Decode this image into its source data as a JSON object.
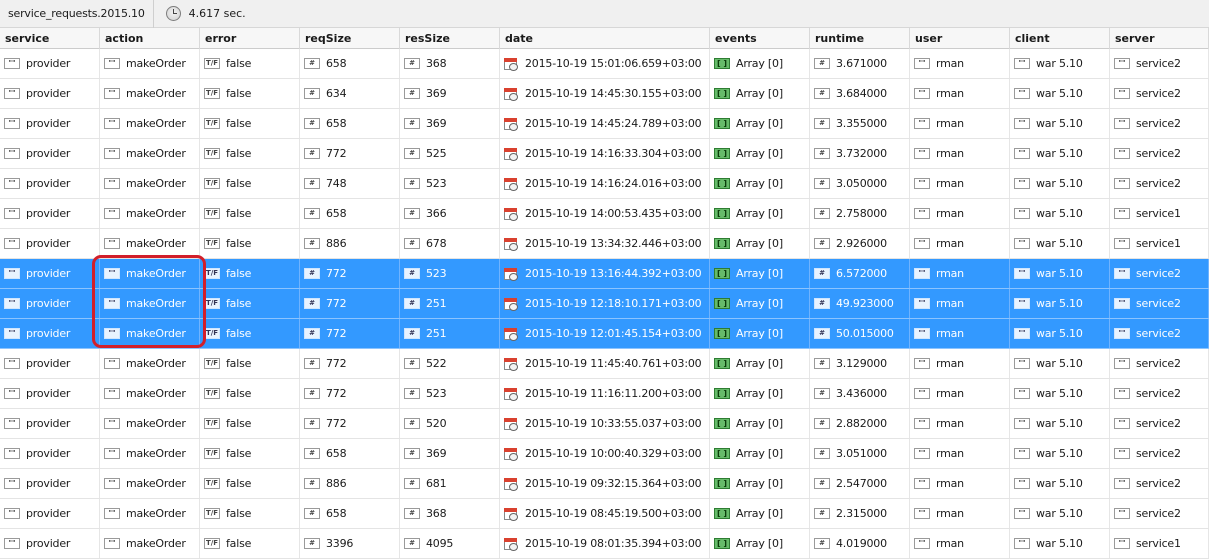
{
  "toolbar": {
    "tab_title": "service_requests.2015.10",
    "elapsed": "4.617 sec."
  },
  "columns": [
    "service",
    "action",
    "error",
    "reqSize",
    "resSize",
    "date",
    "events",
    "runtime",
    "user",
    "client",
    "server"
  ],
  "column_icons": [
    "\"\"",
    "\"\"",
    "T/F",
    "#",
    "#",
    "calendar",
    "array",
    "#",
    "\"\"",
    "\"\"",
    "\"\""
  ],
  "rows": [
    {
      "service": "provider",
      "action": "makeOrder",
      "error": "false",
      "reqSize": "658",
      "resSize": "368",
      "date": "2015-10-19 15:01:06.659+03:00",
      "events": "Array [0]",
      "runtime": "3.671000",
      "user": "rman",
      "client": "war 5.10",
      "server": "service2",
      "selected": false
    },
    {
      "service": "provider",
      "action": "makeOrder",
      "error": "false",
      "reqSize": "634",
      "resSize": "369",
      "date": "2015-10-19 14:45:30.155+03:00",
      "events": "Array [0]",
      "runtime": "3.684000",
      "user": "rman",
      "client": "war 5.10",
      "server": "service2",
      "selected": false
    },
    {
      "service": "provider",
      "action": "makeOrder",
      "error": "false",
      "reqSize": "658",
      "resSize": "369",
      "date": "2015-10-19 14:45:24.789+03:00",
      "events": "Array [0]",
      "runtime": "3.355000",
      "user": "rman",
      "client": "war 5.10",
      "server": "service2",
      "selected": false
    },
    {
      "service": "provider",
      "action": "makeOrder",
      "error": "false",
      "reqSize": "772",
      "resSize": "525",
      "date": "2015-10-19 14:16:33.304+03:00",
      "events": "Array [0]",
      "runtime": "3.732000",
      "user": "rman",
      "client": "war 5.10",
      "server": "service2",
      "selected": false
    },
    {
      "service": "provider",
      "action": "makeOrder",
      "error": "false",
      "reqSize": "748",
      "resSize": "523",
      "date": "2015-10-19 14:16:24.016+03:00",
      "events": "Array [0]",
      "runtime": "3.050000",
      "user": "rman",
      "client": "war 5.10",
      "server": "service2",
      "selected": false
    },
    {
      "service": "provider",
      "action": "makeOrder",
      "error": "false",
      "reqSize": "658",
      "resSize": "366",
      "date": "2015-10-19 14:00:53.435+03:00",
      "events": "Array [0]",
      "runtime": "2.758000",
      "user": "rman",
      "client": "war 5.10",
      "server": "service1",
      "selected": false
    },
    {
      "service": "provider",
      "action": "makeOrder",
      "error": "false",
      "reqSize": "886",
      "resSize": "678",
      "date": "2015-10-19 13:34:32.446+03:00",
      "events": "Array [0]",
      "runtime": "2.926000",
      "user": "rman",
      "client": "war 5.10",
      "server": "service1",
      "selected": false
    },
    {
      "service": "provider",
      "action": "makeOrder",
      "error": "false",
      "reqSize": "772",
      "resSize": "523",
      "date": "2015-10-19 13:16:44.392+03:00",
      "events": "Array [0]",
      "runtime": "6.572000",
      "user": "rman",
      "client": "war 5.10",
      "server": "service2",
      "selected": true
    },
    {
      "service": "provider",
      "action": "makeOrder",
      "error": "false",
      "reqSize": "772",
      "resSize": "251",
      "date": "2015-10-19 12:18:10.171+03:00",
      "events": "Array [0]",
      "runtime": "49.923000",
      "user": "rman",
      "client": "war 5.10",
      "server": "service2",
      "selected": true
    },
    {
      "service": "provider",
      "action": "makeOrder",
      "error": "false",
      "reqSize": "772",
      "resSize": "251",
      "date": "2015-10-19 12:01:45.154+03:00",
      "events": "Array [0]",
      "runtime": "50.015000",
      "user": "rman",
      "client": "war 5.10",
      "server": "service2",
      "selected": true
    },
    {
      "service": "provider",
      "action": "makeOrder",
      "error": "false",
      "reqSize": "772",
      "resSize": "522",
      "date": "2015-10-19 11:45:40.761+03:00",
      "events": "Array [0]",
      "runtime": "3.129000",
      "user": "rman",
      "client": "war 5.10",
      "server": "service2",
      "selected": false
    },
    {
      "service": "provider",
      "action": "makeOrder",
      "error": "false",
      "reqSize": "772",
      "resSize": "523",
      "date": "2015-10-19 11:16:11.200+03:00",
      "events": "Array [0]",
      "runtime": "3.436000",
      "user": "rman",
      "client": "war 5.10",
      "server": "service2",
      "selected": false
    },
    {
      "service": "provider",
      "action": "makeOrder",
      "error": "false",
      "reqSize": "772",
      "resSize": "520",
      "date": "2015-10-19 10:33:55.037+03:00",
      "events": "Array [0]",
      "runtime": "2.882000",
      "user": "rman",
      "client": "war 5.10",
      "server": "service2",
      "selected": false
    },
    {
      "service": "provider",
      "action": "makeOrder",
      "error": "false",
      "reqSize": "658",
      "resSize": "369",
      "date": "2015-10-19 10:00:40.329+03:00",
      "events": "Array [0]",
      "runtime": "3.051000",
      "user": "rman",
      "client": "war 5.10",
      "server": "service2",
      "selected": false
    },
    {
      "service": "provider",
      "action": "makeOrder",
      "error": "false",
      "reqSize": "886",
      "resSize": "681",
      "date": "2015-10-19 09:32:15.364+03:00",
      "events": "Array [0]",
      "runtime": "2.547000",
      "user": "rman",
      "client": "war 5.10",
      "server": "service2",
      "selected": false
    },
    {
      "service": "provider",
      "action": "makeOrder",
      "error": "false",
      "reqSize": "658",
      "resSize": "368",
      "date": "2015-10-19 08:45:19.500+03:00",
      "events": "Array [0]",
      "runtime": "2.315000",
      "user": "rman",
      "client": "war 5.10",
      "server": "service2",
      "selected": false
    },
    {
      "service": "provider",
      "action": "makeOrder",
      "error": "false",
      "reqSize": "3396",
      "resSize": "4095",
      "date": "2015-10-19 08:01:35.394+03:00",
      "events": "Array [0]",
      "runtime": "4.019000",
      "user": "rman",
      "client": "war 5.10",
      "server": "service1",
      "selected": false
    }
  ],
  "colors": {
    "selection": "#3399ff",
    "highlight_border": "#d21f2a",
    "calendar_header": "#d9412f",
    "array_icon": "#66bb6a"
  }
}
